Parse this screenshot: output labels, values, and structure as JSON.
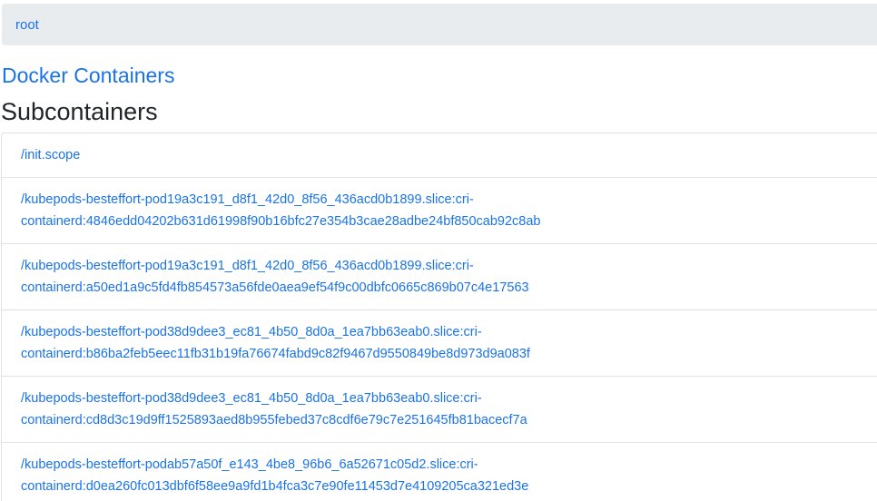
{
  "breadcrumb": {
    "root": "root"
  },
  "title_link": "Docker Containers",
  "section_title": "Subcontainers",
  "subcontainers": [
    {
      "line1": "/init.scope",
      "line2": ""
    },
    {
      "line1": "/kubepods-besteffort-pod19a3c191_d8f1_42d0_8f56_436acd0b1899.slice:cri-",
      "line2": "containerd:4846edd04202b631d61998f90b16bfc27e354b3cae28adbe24bf850cab92c8ab"
    },
    {
      "line1": "/kubepods-besteffort-pod19a3c191_d8f1_42d0_8f56_436acd0b1899.slice:cri-",
      "line2": "containerd:a50ed1a9c5fd4fb854573a56fde0aea9ef54f9c00dbfc0665c869b07c4e17563"
    },
    {
      "line1": "/kubepods-besteffort-pod38d9dee3_ec81_4b50_8d0a_1ea7bb63eab0.slice:cri-",
      "line2": "containerd:b86ba2feb5eec11fb31b19fa76674fabd9c82f9467d9550849be8d973d9a083f"
    },
    {
      "line1": "/kubepods-besteffort-pod38d9dee3_ec81_4b50_8d0a_1ea7bb63eab0.slice:cri-",
      "line2": "containerd:cd8d3c19d9ff1525893aed8b955febed37c8cdf6e79c7e251645fb81bacecf7a"
    },
    {
      "line1": "/kubepods-besteffort-podab57a50f_e143_4be8_96b6_6a52671c05d2.slice:cri-",
      "line2": "containerd:d0ea260fc013dbf6f58ee9a9fd1b4fca3c7e90fe11453d7e4109205ca321ed3e"
    }
  ],
  "colors": {
    "link": "#1a73e8",
    "breadcrumb_bg": "#e9ecef",
    "border": "#dfe2e6",
    "heading": "#212529"
  }
}
